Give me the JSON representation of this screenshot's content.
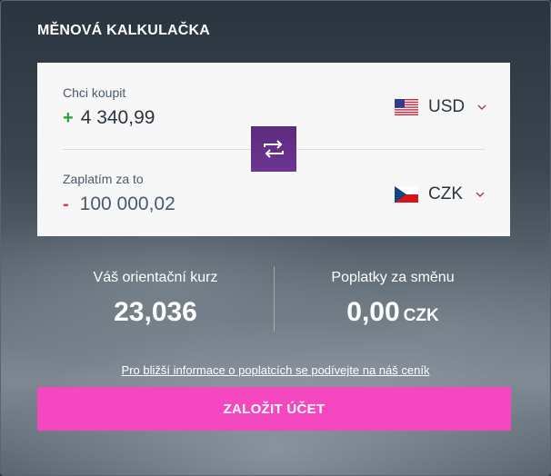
{
  "widget": {
    "title": "MĚNOVÁ KALKULAČKA"
  },
  "buy": {
    "label": "Chci koupit",
    "sign": "+",
    "amount": "4 340,99",
    "currency": "USD",
    "flag_icon": "us-flag-icon"
  },
  "sell": {
    "label": "Zaplatím za to",
    "sign": "-",
    "amount": "100 000,02",
    "currency": "CZK",
    "flag_icon": "cz-flag-icon"
  },
  "rate": {
    "label": "Váš orientační kurz",
    "value": "23,036"
  },
  "fees": {
    "label": "Poplatky za směnu",
    "value": "0,00",
    "unit": "CZK"
  },
  "info_link": "Pro bližší informace o poplatcích se podívejte na náš ceník",
  "cta_label": "ZALOŽIT ÚČET",
  "colors": {
    "accent_pink": "#f548c0",
    "swap_purple": "#6e3592",
    "plus_green": "#23a33a",
    "minus_red": "#e0384c"
  }
}
